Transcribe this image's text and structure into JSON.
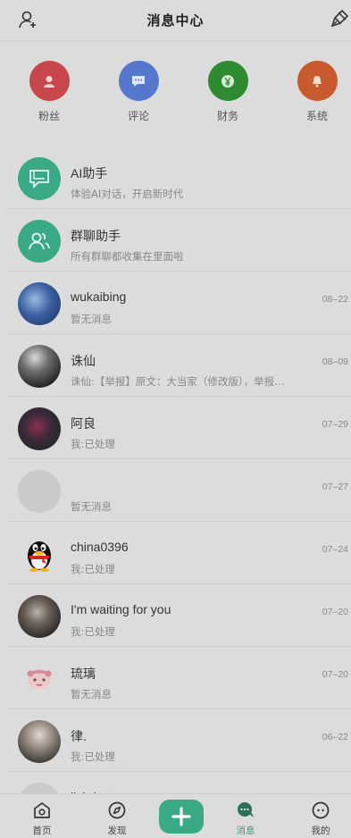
{
  "header": {
    "title": "消息中心",
    "left_icon": "user-add-icon",
    "right_icon": "clear-brush-icon"
  },
  "categories": [
    {
      "label": "粉丝",
      "icon": "user-icon",
      "color": "#c8474a"
    },
    {
      "label": "评论",
      "icon": "comment-icon",
      "color": "#5578cc"
    },
    {
      "label": "财务",
      "icon": "yen-icon",
      "color": "#2e8b32"
    },
    {
      "label": "系统",
      "icon": "bell-icon",
      "color": "#c85a2e"
    }
  ],
  "conversations": [
    {
      "name": "AI助手",
      "message": "体验AI对话，开启新时代",
      "time": "",
      "avatar": "chat-bubble-icon"
    },
    {
      "name": "群聊助手",
      "message": "所有群聊都收集在里面啦",
      "time": "",
      "avatar": "group-icon"
    },
    {
      "name": "wukaibing",
      "message": "暂无消息",
      "time": "08–22",
      "avatar": "photo-avatar"
    },
    {
      "name": "诛仙",
      "message": "诛仙:【举报】原文：大当家（修改版），举报原因：抄袭",
      "time": "08–09",
      "avatar": "photo-avatar"
    },
    {
      "name": "阿良",
      "message": "我:已处理",
      "time": "07–29",
      "avatar": "photo-avatar"
    },
    {
      "name": "",
      "message": "暂无消息",
      "time": "07–27",
      "avatar": "blank-avatar"
    },
    {
      "name": "china0396",
      "message": "我:已处理",
      "time": "07–24",
      "avatar": "penguin-avatar"
    },
    {
      "name": "I'm waiting for you",
      "message": "我:已处理",
      "time": "07–20",
      "avatar": "photo-avatar"
    },
    {
      "name": "琉璃",
      "message": "暂无消息",
      "time": "07–20",
      "avatar": "cartoon-avatar"
    },
    {
      "name": "律.",
      "message": "我:已处理",
      "time": "06–22",
      "avatar": "photo-avatar"
    },
    {
      "name": "lichdert",
      "message": "",
      "time": "",
      "avatar": "blank-avatar"
    }
  ],
  "tabbar": [
    {
      "label": "首页",
      "icon": "home-icon"
    },
    {
      "label": "发现",
      "icon": "compass-icon"
    },
    {
      "label": "",
      "icon": "plus-icon"
    },
    {
      "label": "消息",
      "icon": "message-icon",
      "active": true
    },
    {
      "label": "我的",
      "icon": "profile-icon"
    }
  ]
}
